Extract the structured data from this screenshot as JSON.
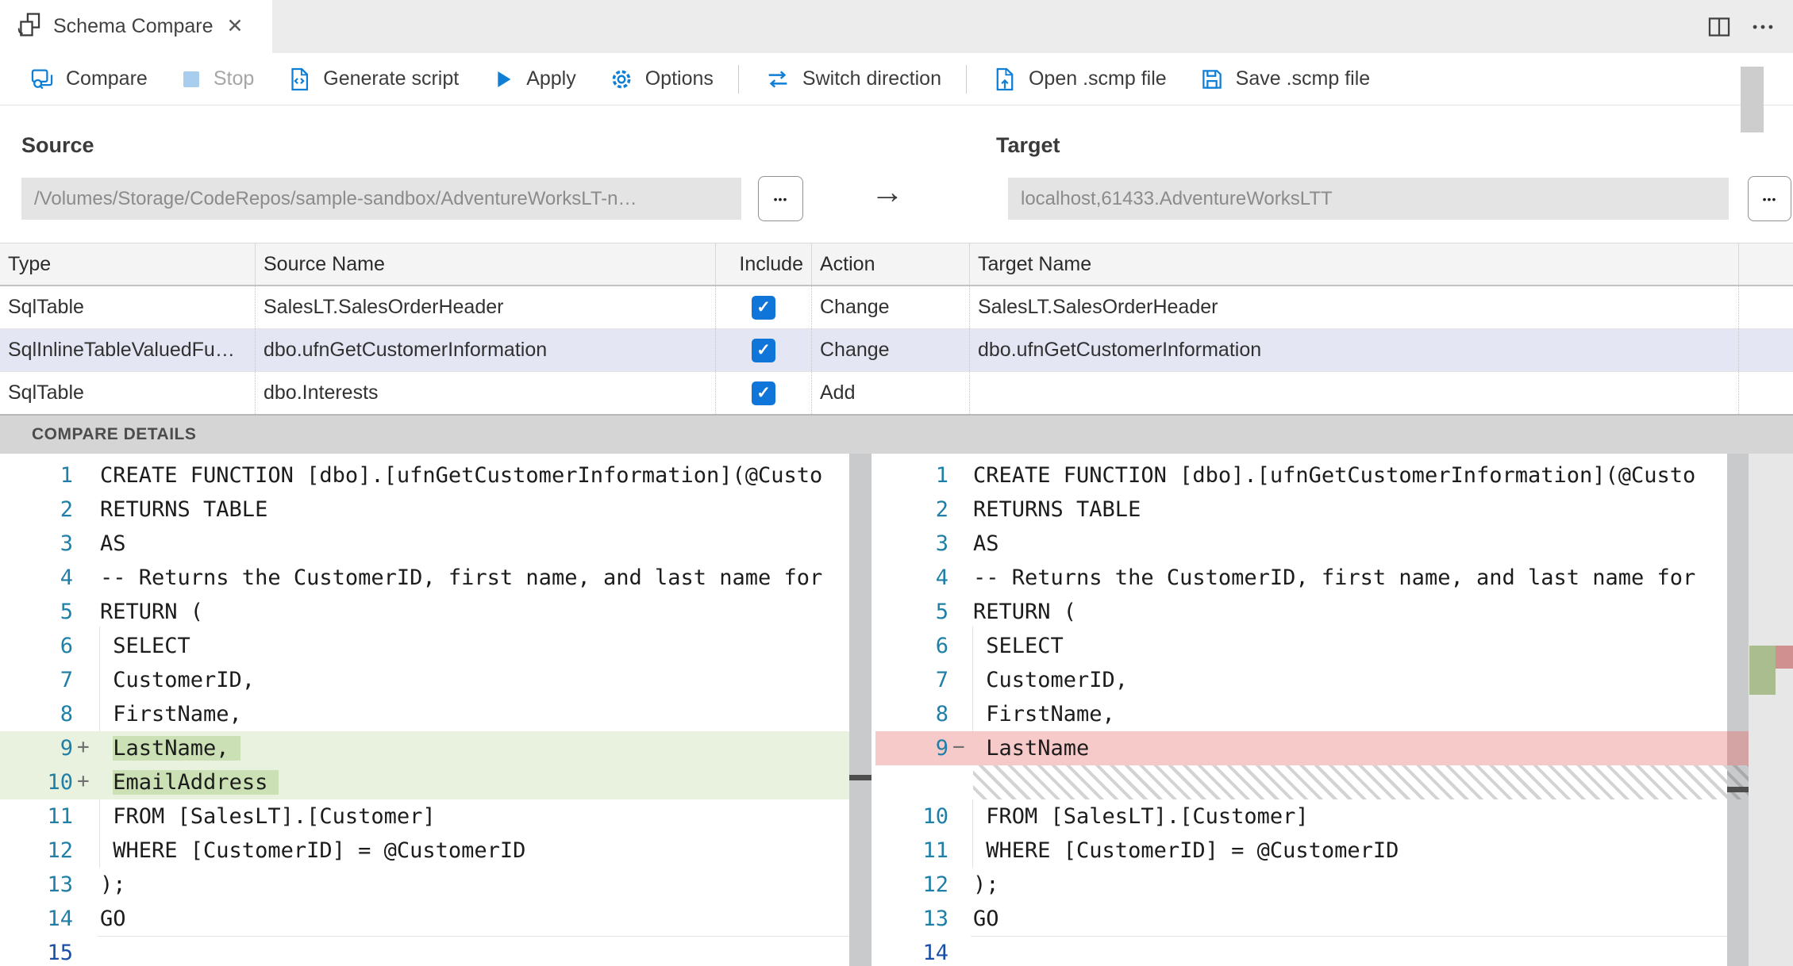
{
  "tab": {
    "title": "Schema Compare"
  },
  "window_icons": {
    "split_editor": "split-editor-icon",
    "more_actions": "more-actions-icon",
    "tab_icon": "schema-compare-icon",
    "close": "close-icon"
  },
  "toolbar": {
    "items": [
      {
        "id": "compare",
        "label": "Compare",
        "icon": "compare-icon",
        "enabled": true
      },
      {
        "id": "stop",
        "label": "Stop",
        "icon": "stop-icon",
        "enabled": false
      },
      {
        "id": "generate-script",
        "label": "Generate script",
        "icon": "generate-script-icon",
        "enabled": true
      },
      {
        "id": "apply",
        "label": "Apply",
        "icon": "apply-icon",
        "enabled": true
      },
      {
        "id": "options",
        "label": "Options",
        "icon": "options-icon",
        "enabled": true
      },
      {
        "id": "sep1",
        "separator": true
      },
      {
        "id": "switch-direction",
        "label": "Switch direction",
        "icon": "switch-direction-icon",
        "enabled": true
      },
      {
        "id": "sep2",
        "separator": true
      },
      {
        "id": "open-scmp",
        "label": "Open .scmp file",
        "icon": "open-file-icon",
        "enabled": true
      },
      {
        "id": "save-scmp",
        "label": "Save .scmp file",
        "icon": "save-file-icon",
        "enabled": true
      }
    ]
  },
  "source": {
    "label": "Source",
    "value": "/Volumes/Storage/CodeRepos/sample-sandbox/AdventureWorksLT-n…",
    "browse_label": "•••"
  },
  "target": {
    "label": "Target",
    "value": "localhost,61433.AdventureWorksLTT",
    "browse_label": "•••"
  },
  "direction_arrow": "→",
  "table": {
    "columns": [
      {
        "label": "Type"
      },
      {
        "label": "Source Name"
      },
      {
        "label": "Include"
      },
      {
        "label": "Action"
      },
      {
        "label": "Target Name"
      }
    ],
    "rows": [
      {
        "type": "SqlTable",
        "source_name": "SalesLT.SalesOrderHeader",
        "include": true,
        "action": "Change",
        "target_name": "SalesLT.SalesOrderHeader",
        "selected": false
      },
      {
        "type": "SqlInlineTableValuedFu…",
        "source_name": "dbo.ufnGetCustomerInformation",
        "include": true,
        "action": "Change",
        "target_name": "dbo.ufnGetCustomerInformation",
        "selected": true
      },
      {
        "type": "SqlTable",
        "source_name": "dbo.Interests",
        "include": true,
        "action": "Add",
        "target_name": "",
        "selected": false
      }
    ]
  },
  "details": {
    "title": "COMPARE DETAILS",
    "left_lines": [
      {
        "n": 1,
        "text": "CREATE FUNCTION [dbo].[ufnGetCustomerInformation](@Custo"
      },
      {
        "n": 2,
        "text": "RETURNS TABLE"
      },
      {
        "n": 3,
        "text": "AS"
      },
      {
        "n": 4,
        "text": "-- Returns the CustomerID, first name, and last name for"
      },
      {
        "n": 5,
        "text": "RETURN ("
      },
      {
        "n": 6,
        "text": " SELECT"
      },
      {
        "n": 7,
        "text": " CustomerID,"
      },
      {
        "n": 8,
        "text": " FirstName,"
      },
      {
        "n": 9,
        "text": " LastName,",
        "change": "add",
        "hl": "LastName,"
      },
      {
        "n": 10,
        "text": " EmailAddress",
        "change": "add",
        "hl": "EmailAddress"
      },
      {
        "n": 11,
        "text": " FROM [SalesLT].[Customer]"
      },
      {
        "n": 12,
        "text": " WHERE [CustomerID] = @CustomerID"
      },
      {
        "n": 13,
        "text": ");"
      },
      {
        "n": 14,
        "text": "GO"
      },
      {
        "n": 15,
        "text": "",
        "active": true
      }
    ],
    "right_lines": [
      {
        "n": 1,
        "text": "CREATE FUNCTION [dbo].[ufnGetCustomerInformation](@Custo"
      },
      {
        "n": 2,
        "text": "RETURNS TABLE"
      },
      {
        "n": 3,
        "text": "AS"
      },
      {
        "n": 4,
        "text": "-- Returns the CustomerID, first name, and last name for"
      },
      {
        "n": 5,
        "text": "RETURN ("
      },
      {
        "n": 6,
        "text": " SELECT"
      },
      {
        "n": 7,
        "text": " CustomerID,"
      },
      {
        "n": 8,
        "text": " FirstName,"
      },
      {
        "n": 9,
        "text": " LastName",
        "change": "del"
      },
      {
        "spacer": true
      },
      {
        "n": 10,
        "text": " FROM [SalesLT].[Customer]"
      },
      {
        "n": 11,
        "text": " WHERE [CustomerID] = @CustomerID"
      },
      {
        "n": 12,
        "text": ");"
      },
      {
        "n": 13,
        "text": "GO"
      },
      {
        "n": 14,
        "text": "",
        "active": true
      }
    ]
  },
  "colors": {
    "accent": "#0f7ed5",
    "selected_row": "#e4e6f3",
    "checkbox": "#1075d8",
    "added_line": "#e9f2de",
    "added_inline": "#cbe0b4",
    "deleted_line": "#f7caca",
    "ruler_added": "#a9bd8f",
    "ruler_deleted": "#d09090"
  }
}
